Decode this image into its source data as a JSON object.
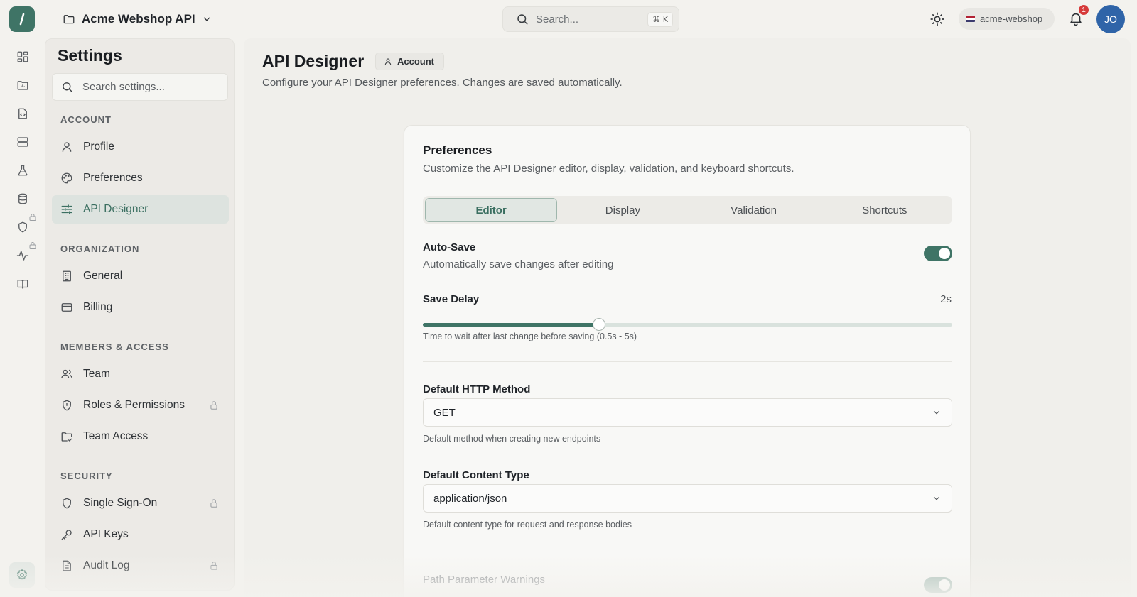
{
  "topbar": {
    "project_name": "Acme Webshop API",
    "search_placeholder": "Search...",
    "search_shortcut": "⌘ K",
    "workspace": "acme-webshop",
    "notifications_count": "1",
    "avatar_initials": "JO"
  },
  "sidebar": {
    "title": "Settings",
    "search_placeholder": "Search settings...",
    "sections": {
      "account": "ACCOUNT",
      "organization": "ORGANIZATION",
      "members": "MEMBERS & ACCESS",
      "security": "SECURITY"
    },
    "items": {
      "profile": "Profile",
      "preferences": "Preferences",
      "api_designer": "API Designer",
      "general": "General",
      "billing": "Billing",
      "team": "Team",
      "roles": "Roles & Permissions",
      "team_access": "Team Access",
      "sso": "Single Sign-On",
      "api_keys": "API Keys",
      "audit_log": "Audit Log"
    }
  },
  "page": {
    "title": "API Designer",
    "chip": "Account",
    "subtitle": "Configure your API Designer preferences. Changes are saved automatically."
  },
  "card": {
    "title": "Preferences",
    "subtitle": "Customize the API Designer editor, display, validation, and keyboard shortcuts.",
    "tabs": [
      "Editor",
      "Display",
      "Validation",
      "Shortcuts"
    ],
    "auto_save": {
      "title": "Auto-Save",
      "description": "Automatically save changes after editing",
      "enabled": true
    },
    "save_delay": {
      "title": "Save Delay",
      "value_label": "2s",
      "value": 2,
      "min": 0.5,
      "max": 5,
      "hint": "Time to wait after last change before saving (0.5s - 5s)"
    },
    "http_method": {
      "title": "Default HTTP Method",
      "value": "GET",
      "hint": "Default method when creating new endpoints"
    },
    "content_type": {
      "title": "Default Content Type",
      "value": "application/json",
      "hint": "Default content type for request and response bodies"
    },
    "path_warnings": {
      "title": "Path Parameter Warnings",
      "enabled": true
    }
  },
  "colors": {
    "accent": "#3f7466",
    "badge": "#d63a3a",
    "avatar": "#2f64a8"
  }
}
